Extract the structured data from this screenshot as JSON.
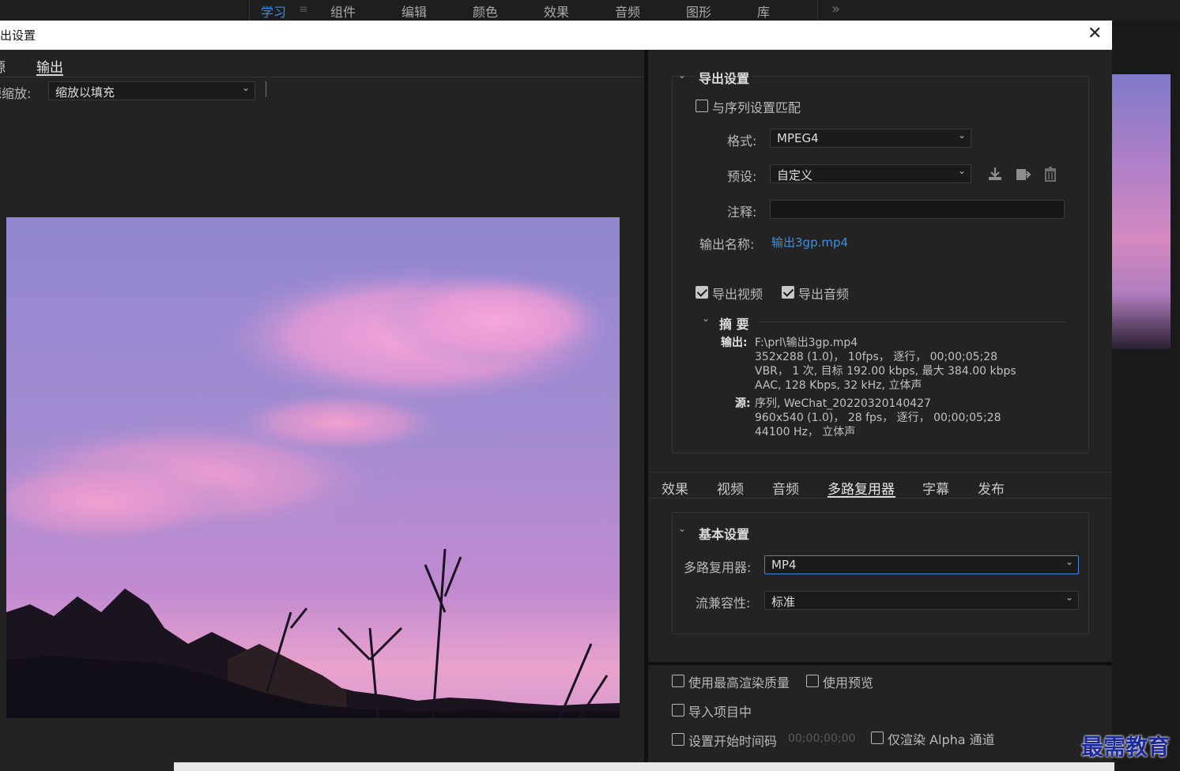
{
  "workspace_bar": {
    "tabs": [
      "学习",
      "组件",
      "编辑",
      "颜色",
      "效果",
      "音频",
      "图形",
      "库"
    ],
    "active": "学习",
    "more": "»"
  },
  "dialog": {
    "title": "出设置",
    "close": "✕"
  },
  "left": {
    "tabs": [
      "源",
      "输出"
    ],
    "active_tab": "输出",
    "scale_label": "源缩放:",
    "scale_value": "缩放以填充"
  },
  "export_settings": {
    "section_title": "导出设置",
    "match_sequence": {
      "label": "与序列设置匹配",
      "checked": false
    },
    "format_label": "格式:",
    "format_value": "MPEG4",
    "preset_label": "预设:",
    "preset_value": "自定义",
    "comment_label": "注释:",
    "comment_value": "",
    "output_name_label": "输出名称:",
    "output_name_value": "输出3gp.mp4",
    "export_video": {
      "label": "导出视频",
      "checked": true
    },
    "export_audio": {
      "label": "导出音频",
      "checked": true
    },
    "summary_title": "摘 要",
    "output_label": "输出:",
    "output_lines": [
      "F:\\prl\\输出3gp.mp4",
      "352x288 (1.0)，  10fps，  逐行，  00;00;05;28",
      "VBR，  1 次, 目标 192.00 kbps, 最大 384.00 kbps",
      "AAC, 128 Kbps, 32  kHz, 立体声"
    ],
    "source_label": "源:",
    "source_lines": [
      "序列, WeChat_20220320140427",
      "960x540 (1.0)，  28 fps，  逐行，  00;00;05;28",
      "44100 Hz，  立体声"
    ]
  },
  "settings_tabs": {
    "tabs": [
      "效果",
      "视频",
      "音频",
      "多路复用器",
      "字幕",
      "发布"
    ],
    "active": "多路复用器"
  },
  "basic_settings": {
    "section_title": "基本设置",
    "multiplexer_label": "多路复用器:",
    "multiplexer_value": "MP4",
    "stream_compat_label": "流兼容性:",
    "stream_compat_value": "标准"
  },
  "bottom_options": {
    "max_render_quality": {
      "label": "使用最高渲染质量",
      "checked": false
    },
    "use_previews": {
      "label": "使用预览",
      "checked": false
    },
    "import_into_project": {
      "label": "导入项目中",
      "checked": false
    },
    "set_start_timecode": {
      "label": "设置开始时间码",
      "checked": false
    },
    "start_timecode_value": "00;00;00;00",
    "render_alpha_only": {
      "label": "仅渲染 Alpha 通道",
      "checked": false
    }
  },
  "icons": {
    "save_preset": "download-icon",
    "import_preset": "import-preset-icon",
    "delete_preset": "trash-icon"
  },
  "watermark": "最需教育",
  "colors": {
    "accent": "#2f8ff0",
    "link": "#3b8fe6",
    "panel": "#232323"
  }
}
